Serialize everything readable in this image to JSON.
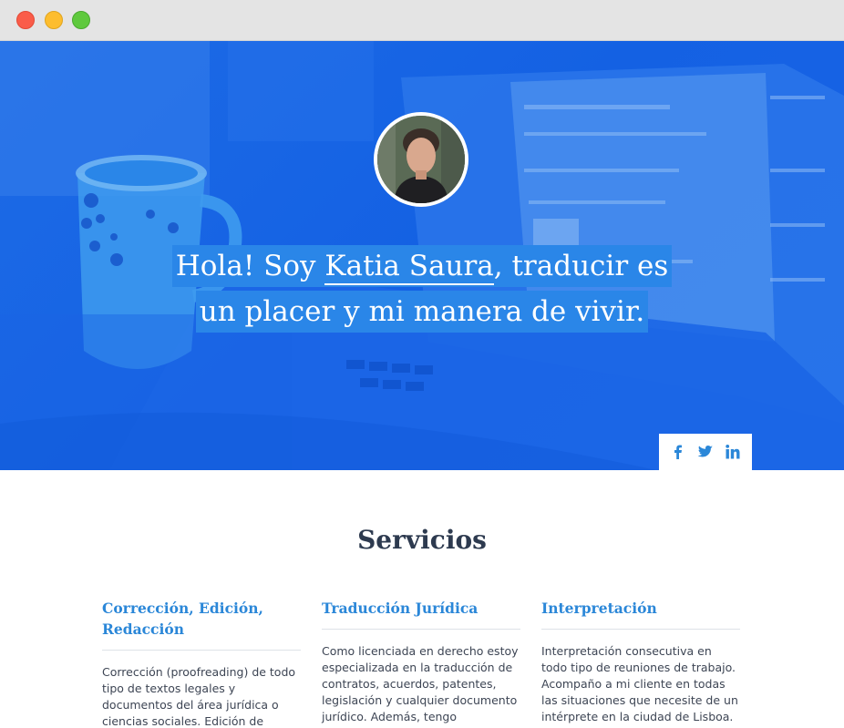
{
  "hero": {
    "headline_part1": "Hola! Soy ",
    "headline_name": "Katia Saura",
    "headline_part2": ", traducir es",
    "headline_line2": "un placer y mi manera de vivir.",
    "avatar_alt": "Katia Saura",
    "accent_color": "#1461e3"
  },
  "social": {
    "facebook": "facebook-icon",
    "twitter": "twitter-icon",
    "linkedin": "linkedin-icon"
  },
  "services": {
    "title": "Servicios",
    "items": [
      {
        "title": "Corrección, Edición, Redacción",
        "text": "Corrección (proofreading) de todo tipo de textos legales y documentos del área jurídica o ciencias sociales. Edición de documentos legales así"
      },
      {
        "title": "Traducción Jurídica",
        "text": "Como licenciada en derecho estoy especializada en la traducción de contratos, acuerdos, patentes, legislación y cualquier documento jurídico. Además, tengo experiencia"
      },
      {
        "title": "Interpretación",
        "text": "Interpretación consecutiva en todo tipo de reuniones de trabajo. Acompaño a mi cliente en todas las situaciones que necesite de un intérprete en la ciudad de Lisboa."
      }
    ]
  }
}
